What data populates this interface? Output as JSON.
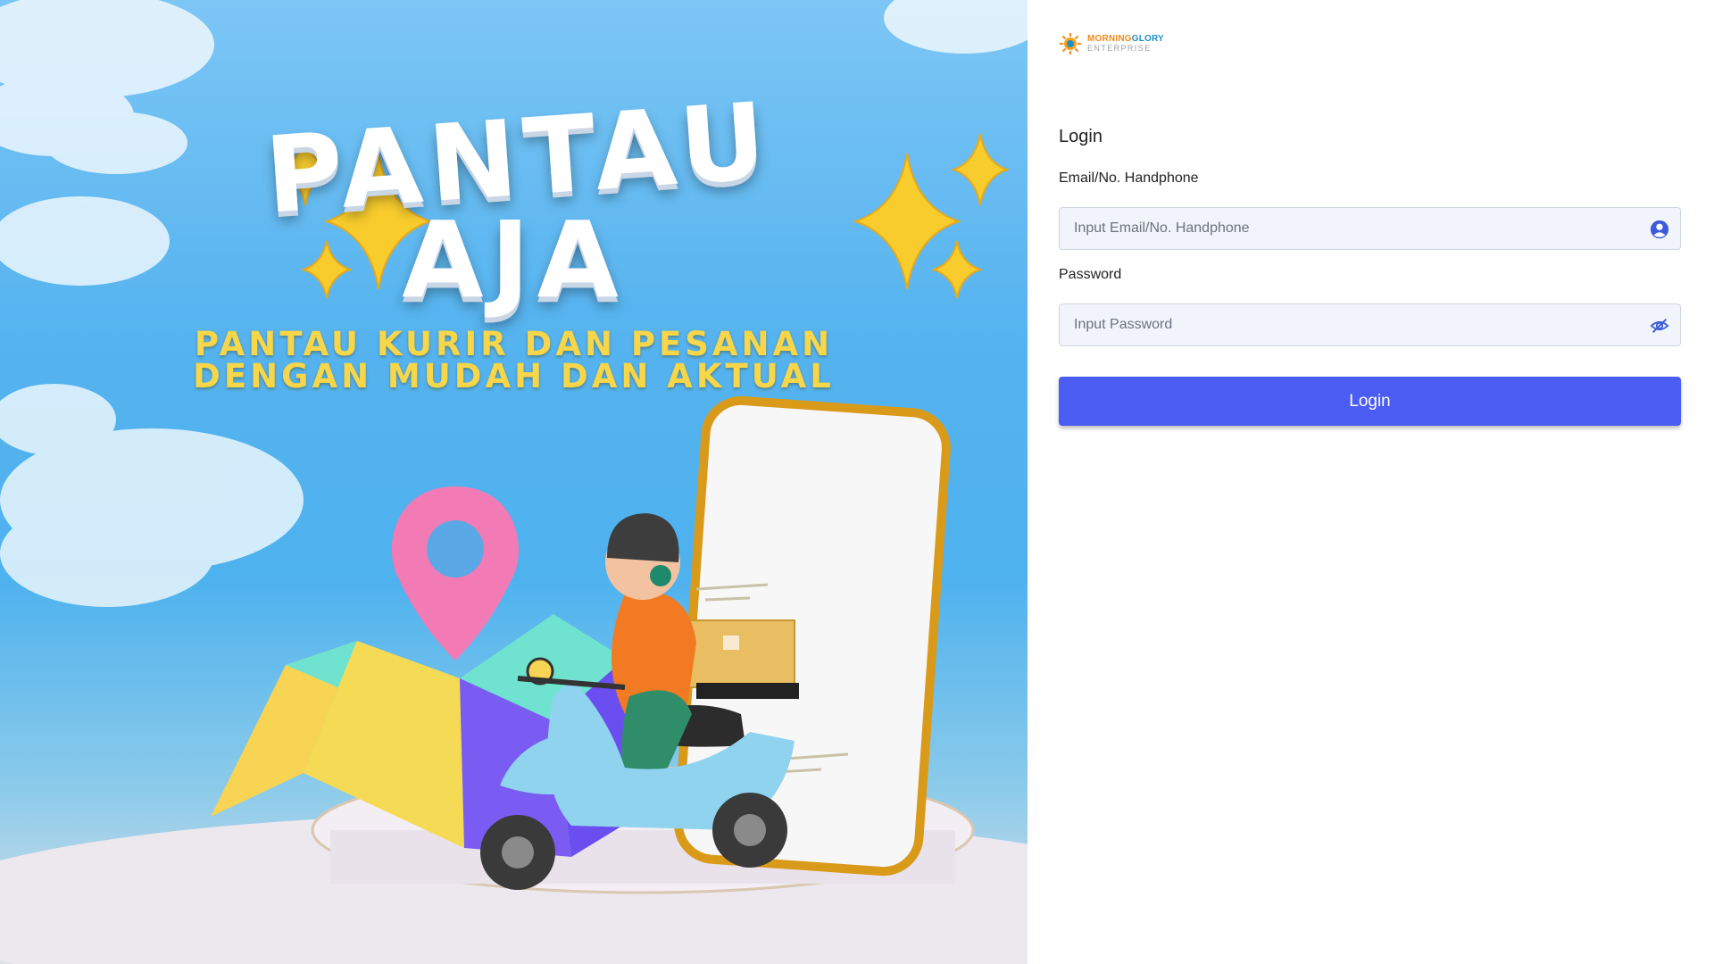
{
  "hero": {
    "title_line1": "PANTAU",
    "title_line2": "AJA",
    "subtitle_line1": "PANTAU KURIR DAN PESANAN",
    "subtitle_line2": "DENGAN MUDAH DAN AKTUAL"
  },
  "brand": {
    "logo_top_a": "MORNING",
    "logo_top_b": "GLORY",
    "logo_bottom": "ENTERPRISE",
    "accent": "#4a5cf1"
  },
  "login": {
    "title": "Login",
    "email_label": "Email/No. Handphone",
    "email_placeholder": "Input Email/No. Handphone",
    "email_icon": "user-circle-icon",
    "password_label": "Password",
    "password_placeholder": "Input Password",
    "password_icon": "eye-slash-icon",
    "button_label": "Login"
  }
}
